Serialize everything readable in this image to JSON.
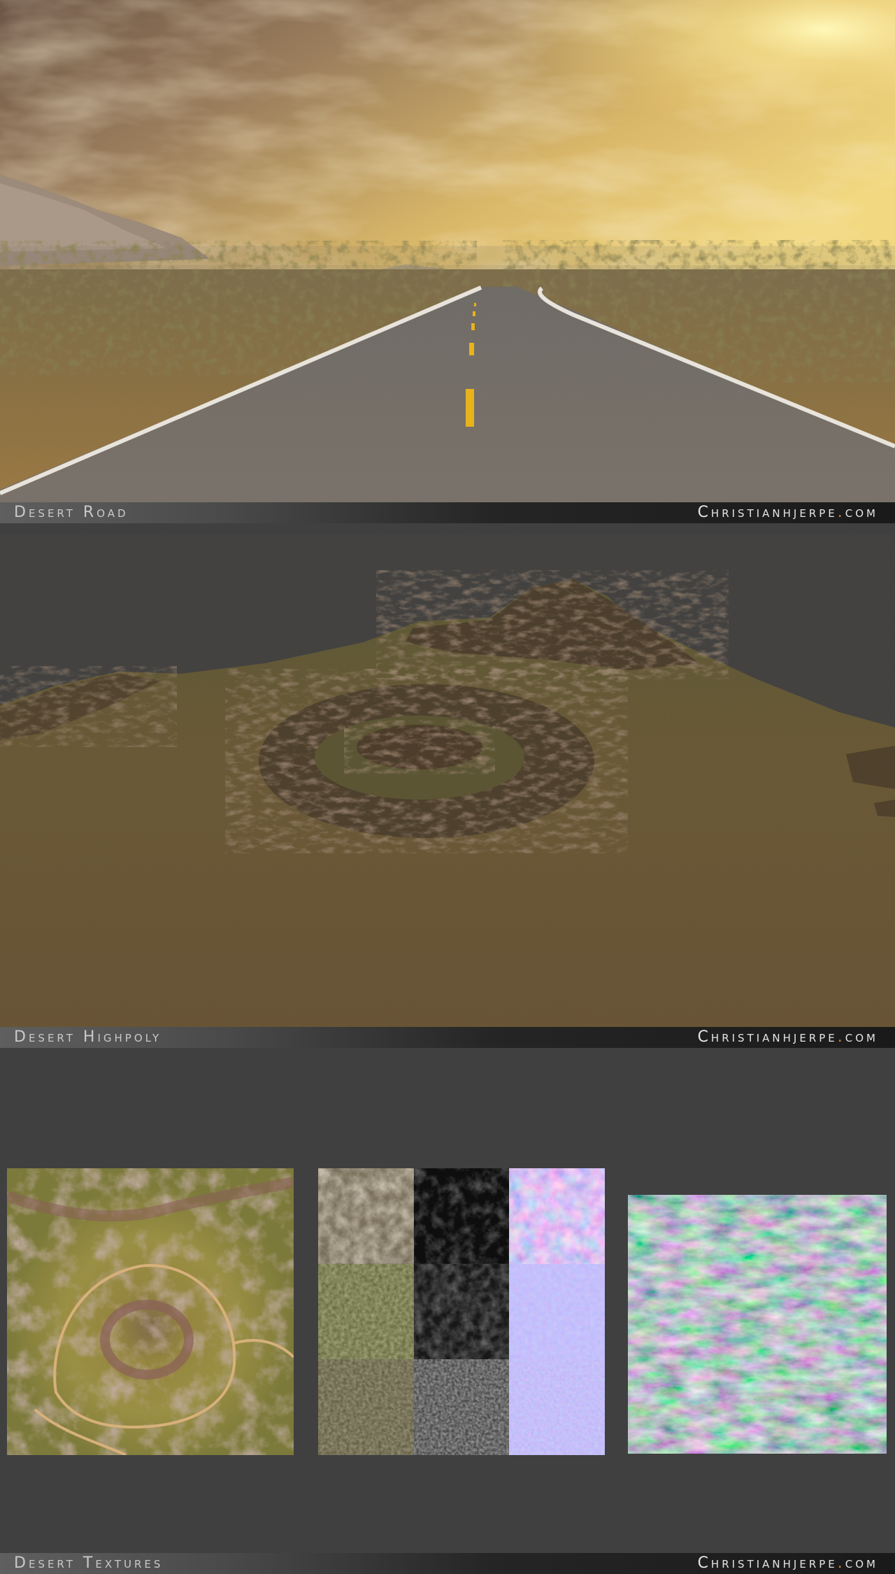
{
  "sections": [
    {
      "title": "Desert Road",
      "site": "Christianhjerpe",
      "site_dot": ".",
      "site_tld": "com"
    },
    {
      "title": "Desert Highpoly",
      "site": "Christianhjerpe",
      "site_dot": ".",
      "site_tld": "com"
    },
    {
      "title": "Desert Textures",
      "site": "Christianhjerpe",
      "site_dot": ".",
      "site_tld": "com"
    }
  ],
  "colors": {
    "background": "#404040",
    "accent_dot": "#e07a20",
    "road_line_yellow": "#e8b21a",
    "road_line_white": "#e8e4dc"
  }
}
